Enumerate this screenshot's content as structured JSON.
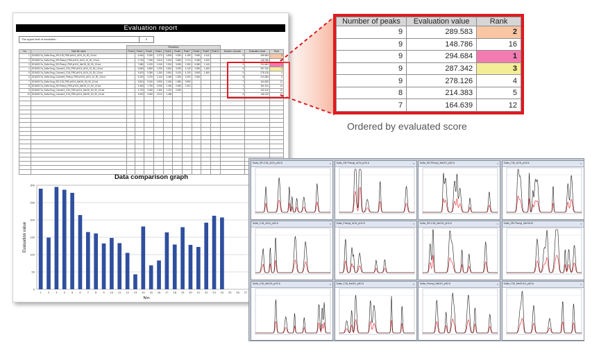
{
  "report": {
    "title": "Evaluation report",
    "upper_limit_label": "The upper limit of resolution :",
    "upper_limit_value": "0",
    "group_header": "Resolution",
    "headers": [
      "No.",
      "Data file name",
      "Peak1",
      "Peak2",
      "Peak3",
      "Peak4",
      "Peak5",
      "Peak6",
      "Peak7",
      "Peak8",
      "Peak9",
      "Peak10",
      "Number of peaks",
      "Evaluation value",
      "Rank"
    ],
    "rows": [
      {
        "no": "1",
        "file": "20160217a_Sulfa Drug_SR-C18_PBS pH2.6_ACN_10_50_13.lcd",
        "vals": [
          "-",
          "3.600",
          "5.290",
          "1.270",
          "3.820",
          "0.930",
          "4.159",
          "3.690",
          "1.510"
        ],
        "peaks": "9",
        "score": "289.583",
        "rank": "2",
        "rank_color": "orange"
      },
      {
        "no": "2",
        "file": "20160217a_Sulfa Drug_SR-Phenyl_PBS pH2.6_ACN_10_50_13.lcd",
        "vals": [
          "-",
          "2.730",
          "7.490",
          "0.910",
          "2.910",
          "0.980",
          "2.710",
          "3.060",
          "0.190"
        ],
        "peaks": "9",
        "score": "148.786",
        "rank": "16",
        "rank_color": ""
      },
      {
        "no": "3",
        "file": "20160217a_Sulfa Drug_SR-Phenyl_PBS pH2.6_MeOH_50_90_13.lcd",
        "vals": [
          "-",
          "7.680",
          "5.220",
          "1.040",
          "2.910",
          "3.090",
          "1.050",
          "5.080",
          "1.140"
        ],
        "peaks": "9",
        "score": "294.684",
        "rank": "1",
        "rank_color": "pink"
      },
      {
        "no": "4",
        "file": "20160217a_Sulfa Drug_Column3_C30_PBS pH2.6_ACN_10_50_13.lcd",
        "vals": [
          "-",
          "3.660",
          "5.800",
          "1.290",
          "3.810",
          "3.090",
          "4.140",
          "3.690",
          "1.460"
        ],
        "peaks": "9",
        "score": "287.342",
        "rank": "3",
        "rank_color": "yellow"
      },
      {
        "no": "5",
        "file": "20160217a_Sulfa Drug_Column4_C18_PBS pH2.6_ACN_10_50_13.lcd",
        "vals": [
          "-",
          "3.620",
          "5.280",
          "1.260",
          "3.810",
          "3.100",
          "4.130",
          "3.600",
          "1.460"
        ],
        "peaks": "9",
        "score": "278.126",
        "rank": "4",
        "rank_color": ""
      },
      {
        "no": "6",
        "file": "20160217a_Sulfa Drug_Column5_Phenyl_PBS pH2.6_ACN_10_50_13.lcd",
        "vals": [
          "-",
          "5.200",
          "3.070",
          "2.144",
          "3.460",
          "1.090",
          "3.000",
          "2.640",
          ""
        ],
        "peaks": "8",
        "score": "214.383",
        "rank": "5",
        "rank_color": ""
      },
      {
        "no": "7",
        "file": "20160217a_Sulfa Drug_SR-C18_PBS pH2.6_MeOH_50_90_13.lcd",
        "vals": [
          "-",
          "3.810",
          "5.150",
          "0.990",
          "2.340",
          "1.980",
          "3.950",
          "",
          "",
          ""
        ],
        "peaks": "7",
        "score": "164.639",
        "rank": "12",
        "rank_color": ""
      },
      {
        "no": "8",
        "file": "20160217a_Sulfa Drug_SR-Phenyl_PBS pH2.6_MeOH_10_50_13.lcd",
        "vals": [
          "-",
          "3.450",
          "1.790",
          "2.056",
          "1.400",
          "2.080",
          "1.510",
          "",
          "",
          ""
        ],
        "peaks": "7",
        "score": "161.514",
        "rank": "14",
        "rank_color": ""
      },
      {
        "no": "9",
        "file": "20160217a_Sulfa Drug_Column3_C30_PBS pH2.6_MeOH_50_90_13.lcd",
        "vals": [
          "-",
          "3.720",
          "3.060",
          "1.360",
          "1.210",
          "2.060",
          "",
          "",
          "",
          ""
        ],
        "peaks": "7",
        "score": "132.410",
        "rank": "15",
        "rank_color": ""
      },
      {
        "no": "10",
        "file": "20160217a_Sulfa Drug_Column4_C18_PBS pH2.6_MeOH_50_90_13.lcd",
        "vals": [
          "-",
          "3.620",
          "3.460",
          "2.010",
          "1.460",
          "",
          "",
          "",
          "",
          ""
        ],
        "peaks": "6",
        "score": "148.133",
        "rank": "17",
        "rank_color": ""
      }
    ],
    "total_rows": 28
  },
  "graph": {
    "title": "Data comparison graph",
    "ylabel": "Evaluation value",
    "xlabel": "No."
  },
  "chart_data": {
    "type": "bar",
    "title": "Data comparison graph",
    "xlabel": "No.",
    "ylabel": "Evaluation value",
    "categories": [
      "1",
      "2",
      "3",
      "4",
      "5",
      "6",
      "7",
      "8",
      "9",
      "10",
      "11",
      "12",
      "13",
      "14",
      "15",
      "16",
      "17",
      "18",
      "19",
      "20",
      "21",
      "22",
      "23",
      "24",
      "25",
      "26",
      "27",
      "28"
    ],
    "values": [
      290,
      149,
      295,
      287,
      278,
      214,
      165,
      161,
      132,
      148,
      133,
      105,
      43,
      181,
      69,
      83,
      164,
      129,
      179,
      128,
      122,
      192,
      212,
      207,
      0,
      0,
      0,
      0
    ],
    "ylim": [
      0,
      300
    ],
    "yticks": [
      0,
      50,
      100,
      150,
      200,
      250,
      300
    ],
    "grid": true,
    "bar_color": "#2f4f9e"
  },
  "zoom": {
    "headers": [
      "Number of peaks",
      "Evaluation value",
      "Rank"
    ],
    "rows": [
      {
        "peaks": "9",
        "score": "289.583",
        "rank": "2",
        "color": "orange"
      },
      {
        "peaks": "9",
        "score": "148.786",
        "rank": "16",
        "color": ""
      },
      {
        "peaks": "9",
        "score": "294.684",
        "rank": "1",
        "color": "pink"
      },
      {
        "peaks": "9",
        "score": "287.342",
        "rank": "3",
        "color": "yellow"
      },
      {
        "peaks": "9",
        "score": "278.126",
        "rank": "4",
        "color": ""
      },
      {
        "peaks": "8",
        "score": "214.383",
        "rank": "5",
        "color": ""
      },
      {
        "peaks": "7",
        "score": "164.639",
        "rank": "12",
        "color": ""
      }
    ],
    "caption": "Ordered by evaluated score"
  },
  "chromatograms": {
    "panel_titles": [
      "Sulfa_SR-C18_ACN_pH2.6",
      "Sulfa_SR-Phenyl_ACN_pH2.6",
      "Sulfa_SR-Phenyl_MeOH_pH2.6",
      "Sulfa_C30_ACN_pH2.6",
      "Sulfa_C18_ACN_pH2.6",
      "Sulfa_Phenyl_ACN_pH2.6",
      "Sulfa_SR-C18_MeOH_pH2.6",
      "Sulfa_SR-Phenyl_MeOH10",
      "Sulfa_C30_MeOH_pH2.6",
      "Sulfa_C18_MeOH_pH2.6",
      "Sulfa_Phenyl_MeOH_pH2.6",
      "Sulfa_C30_MeOH10_pH2.6"
    ],
    "line_colors": {
      "trace": "#1a1a1a",
      "reference": "#e0191f"
    }
  }
}
